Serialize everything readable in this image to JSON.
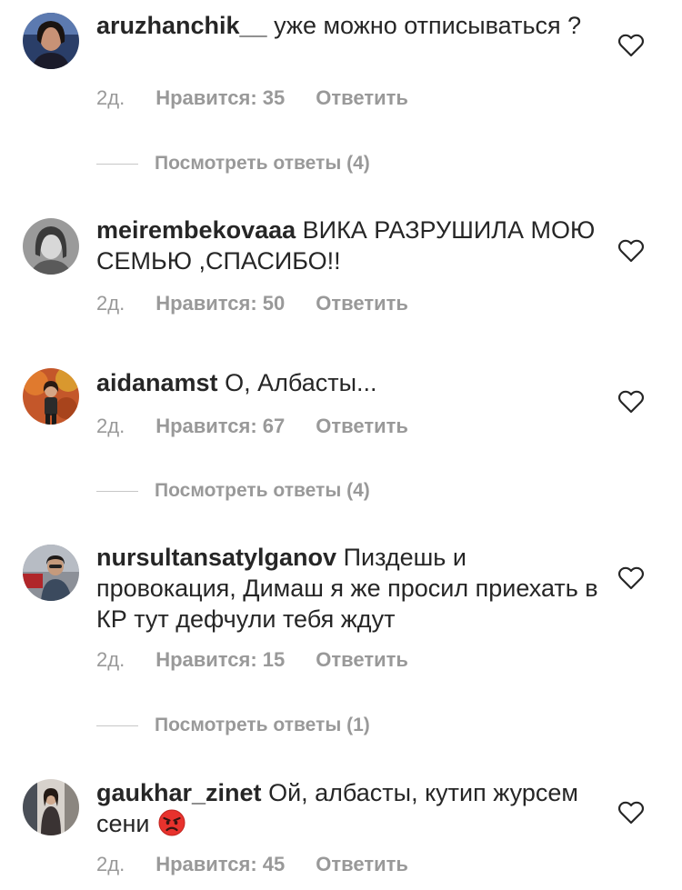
{
  "comments": [
    {
      "username": "aruzhanchik__",
      "text": "уже можно отписываться ?",
      "time": "2д.",
      "likes": "Нравится: 35",
      "reply": "Ответить",
      "view_replies": "Посмотреть ответы (4)"
    },
    {
      "username": "meirembekovaaa",
      "text": "ВИКА РАЗРУШИЛА МОЮ СЕМЬЮ ,СПАСИБО!!",
      "time": "2д.",
      "likes": "Нравится: 50",
      "reply": "Ответить"
    },
    {
      "username": "aidanamst",
      "text": "О, Албасты...",
      "time": "2д.",
      "likes": "Нравится: 67",
      "reply": "Ответить",
      "view_replies": "Посмотреть ответы (4)"
    },
    {
      "username": "nursultansatylganov",
      "text": "Пиздешь и провокация, Димаш я же просил приехать в КР тут дефчули тебя ждут",
      "time": "2д.",
      "likes": "Нравится: 15",
      "reply": "Ответить",
      "view_replies": "Посмотреть ответы (1)"
    },
    {
      "username": "gaukhar_zinet",
      "text": "Ой, албасты, кутип журсем сени",
      "emoji": "angry-face-emoji",
      "time": "2д.",
      "likes": "Нравится: 45",
      "reply": "Ответить"
    }
  ],
  "colors": {
    "text": "#262626",
    "meta": "#999999",
    "divider": "#c7c7c7",
    "heart_outline": "#262626"
  },
  "icons": {
    "like": "heart-outline-icon"
  }
}
